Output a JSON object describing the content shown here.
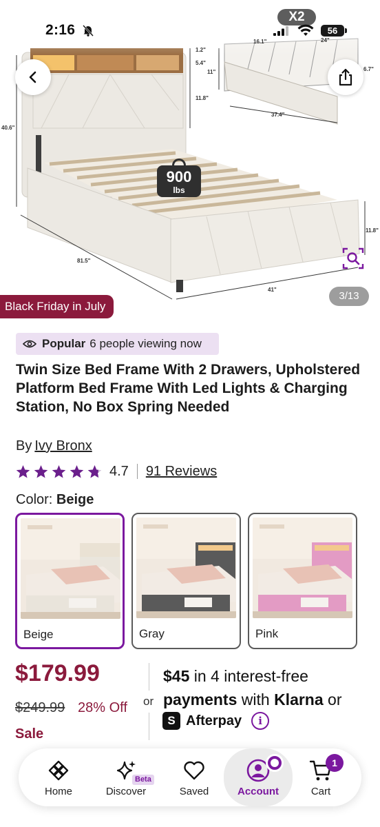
{
  "status_bar": {
    "time": "2:16",
    "recording_badge": "X2",
    "battery": "56"
  },
  "gallery": {
    "counter": "3/13",
    "promo_tag": "Black Friday in July",
    "weight_value": "900",
    "weight_unit": "lbs",
    "dims": {
      "shelf": "1.2\"",
      "shelf_height": "5.4\"",
      "headboard_gap": "11.8\"",
      "total_height": "40.6\"",
      "side_height": "11.8\"",
      "length": "81.5\"",
      "width": "41\"",
      "drawer_depth": "16.1\"",
      "drawer_width": "24\"",
      "drawer_height": "11\"",
      "drawer_front": "6.7\"",
      "drawer_length": "37.4\""
    }
  },
  "product": {
    "popular_label": "Popular",
    "popular_text": "6 people viewing now",
    "title": "Twin Size Bed Frame With 2 Drawers, Upholstered Platform Bed Frame With Led Lights & Charging Station, No Box Spring Needed",
    "by_prefix": "By",
    "brand": "Ivy Bronx",
    "rating": "4.7",
    "rating_stars": 4.7,
    "reviews": "91 Reviews",
    "color_prefix": "Color:",
    "color_selected": "Beige",
    "swatches": [
      {
        "label": "Beige",
        "color": "#e9e4db",
        "selected": true
      },
      {
        "label": "Gray",
        "color": "#5a5a5a",
        "selected": false
      },
      {
        "label": "Pink",
        "color": "#e39bc4",
        "selected": false
      }
    ]
  },
  "pricing": {
    "price": "$179.99",
    "old_price": "$249.99",
    "discount": "28% Off",
    "sale": "Sale",
    "or": "or",
    "klarna_amount": "$45",
    "klarna_text_1": "in 4 interest-free",
    "klarna_bold": "payments",
    "klarna_text_2": "with",
    "klarna_brand": "Klarna",
    "klarna_or": "or",
    "afterpay_logo": "S",
    "afterpay": "Afterpay",
    "info_icon": "i"
  },
  "nav": {
    "home": "Home",
    "discover": "Discover",
    "beta": "Beta",
    "saved": "Saved",
    "account": "Account",
    "cart": "Cart",
    "cart_count": "1"
  },
  "colors": {
    "accent": "#7b189f",
    "price": "#8b1a3c",
    "popular_bg": "#ece0f2"
  }
}
